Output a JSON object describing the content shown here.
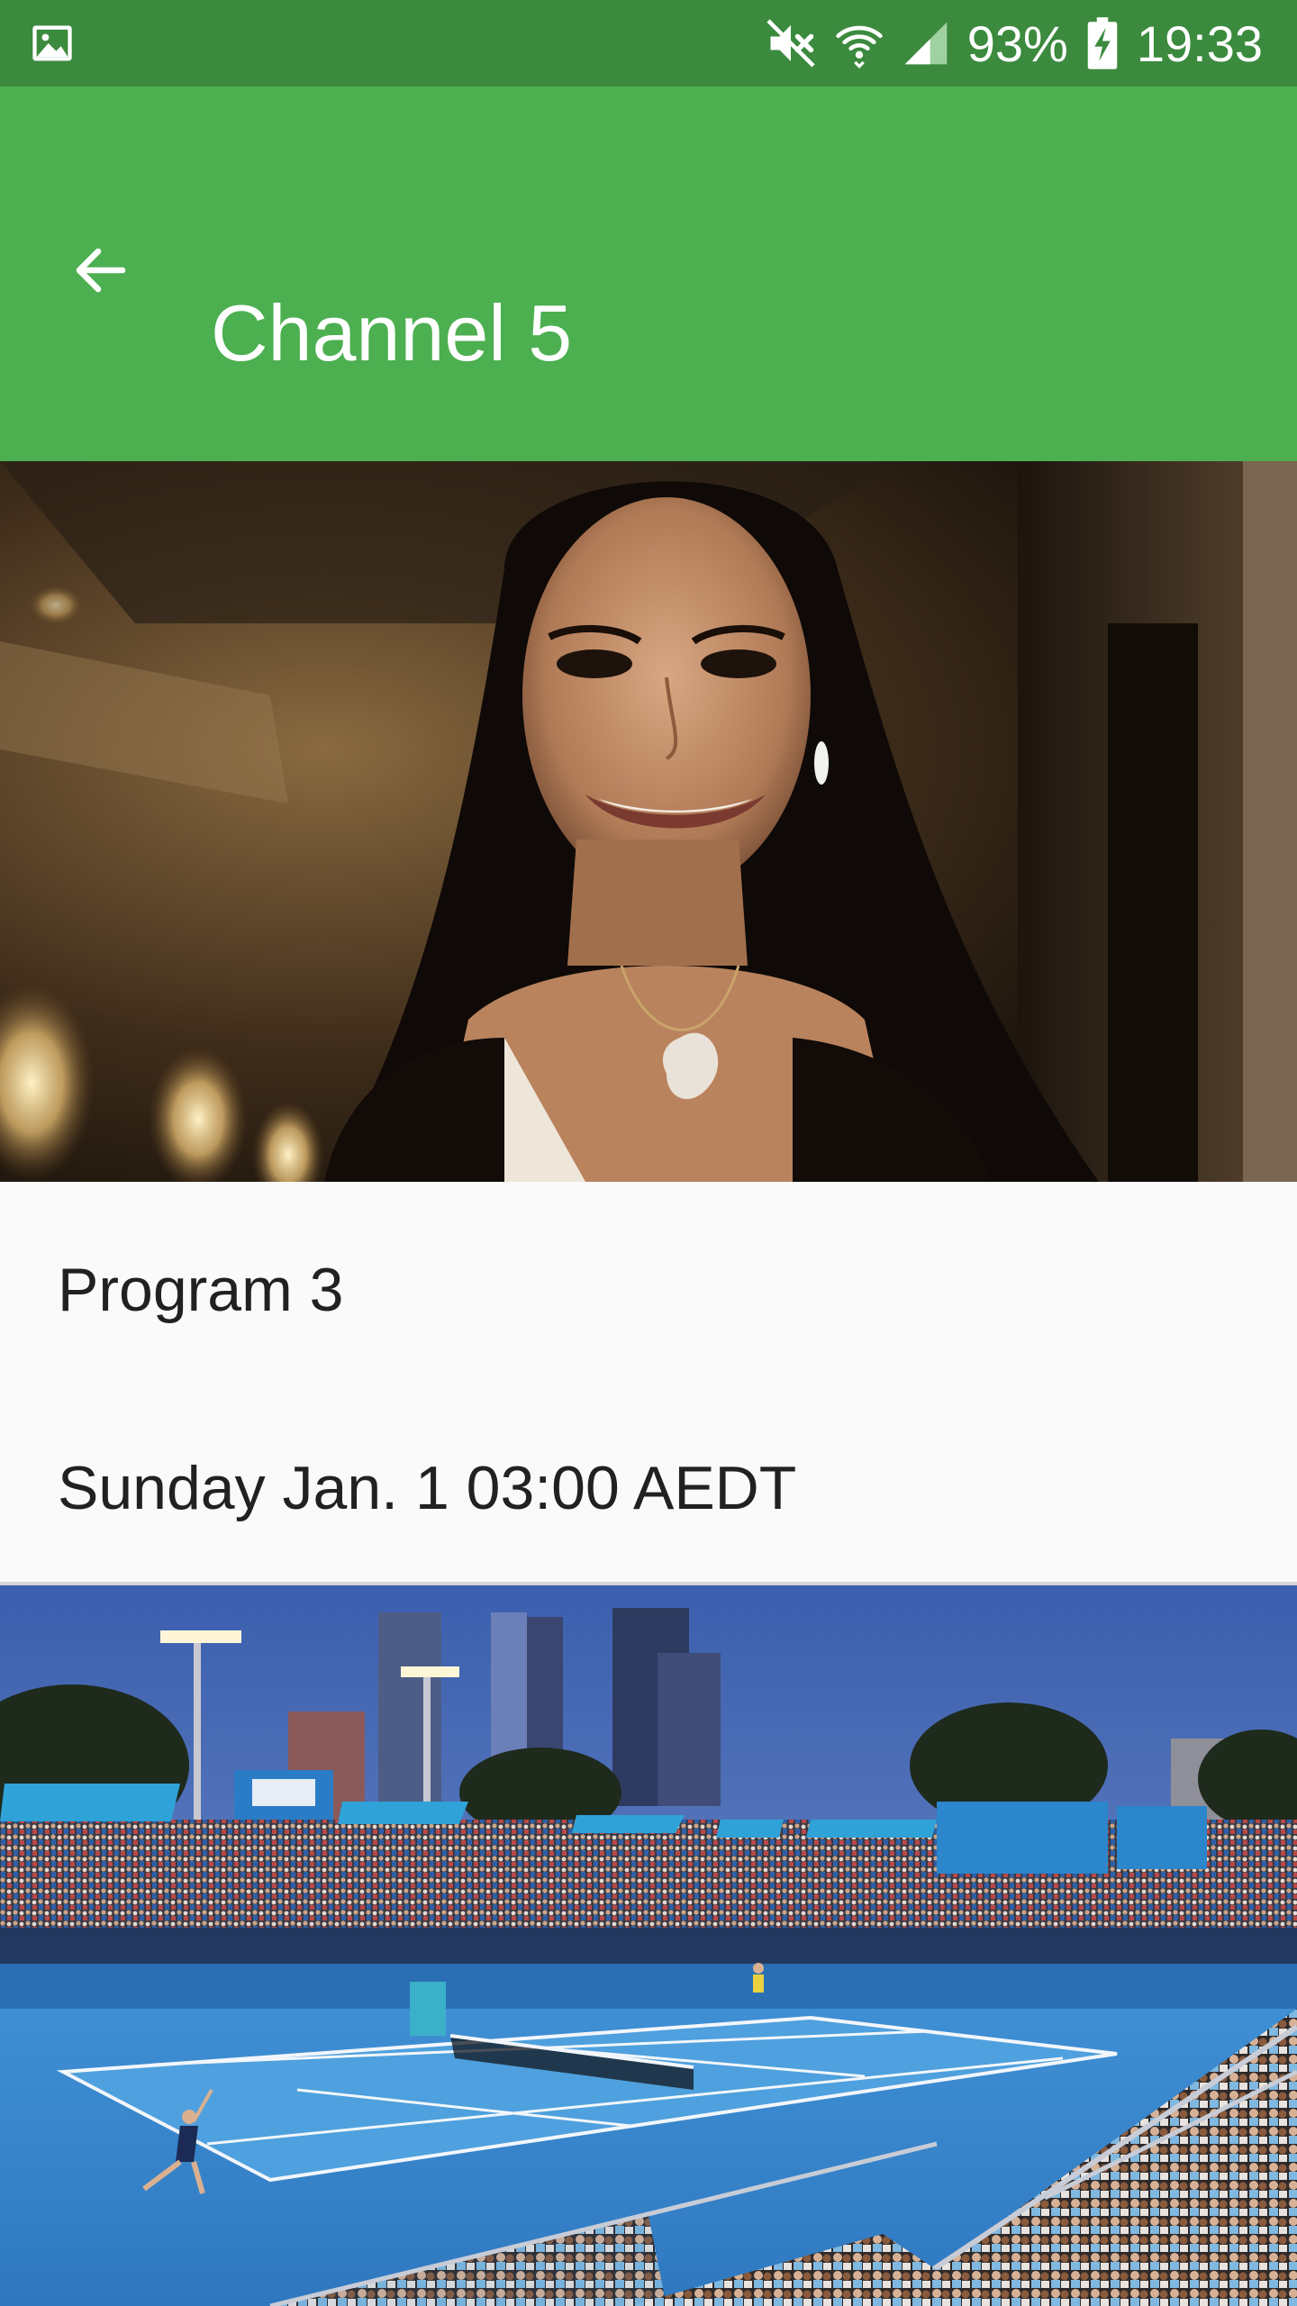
{
  "status_bar": {
    "left_icon": "image-notification-icon",
    "icons": [
      "mute-icon",
      "wifi-icon",
      "signal-icon",
      "battery-charging-icon"
    ],
    "battery_percent": "93%",
    "time": "19:33"
  },
  "app_bar": {
    "back_icon": "arrow-back-icon",
    "title": "Channel 5",
    "color": "#4caf50",
    "status_color": "#3b8a3e"
  },
  "hero_image": {
    "description_icon": "program-thumbnail-image"
  },
  "program": {
    "name": "Program 3",
    "time": "Sunday Jan. 1 03:00 AEDT"
  },
  "secondary_image": {
    "description_icon": "tennis-stadium-image"
  }
}
